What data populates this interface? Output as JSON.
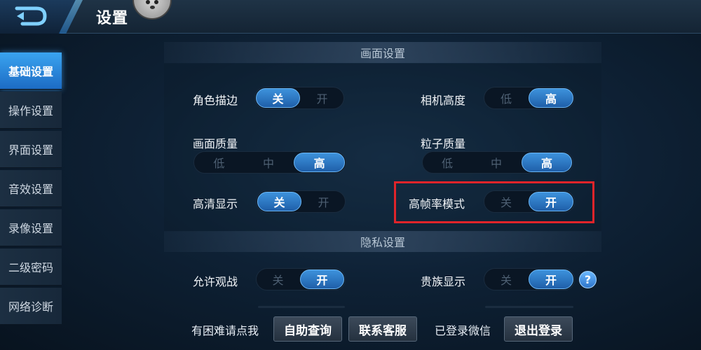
{
  "header": {
    "title": "设置"
  },
  "sidebar": {
    "items": [
      {
        "label": "基础设置",
        "active": true
      },
      {
        "label": "操作设置"
      },
      {
        "label": "界面设置"
      },
      {
        "label": "音效设置"
      },
      {
        "label": "录像设置"
      },
      {
        "label": "二级密码"
      },
      {
        "label": "网络诊断"
      }
    ]
  },
  "display_section": {
    "title": "画面设置",
    "settings": {
      "outline": {
        "label": "角色描边",
        "options": [
          "关",
          "开"
        ],
        "selected": "关"
      },
      "camera_height": {
        "label": "相机高度",
        "options": [
          "低",
          "高"
        ],
        "selected": "高"
      },
      "image_quality": {
        "label": "画面质量",
        "options": [
          "低",
          "中",
          "高"
        ],
        "selected": "高"
      },
      "particle_quality": {
        "label": "粒子质量",
        "options": [
          "低",
          "中",
          "高"
        ],
        "selected": "高"
      },
      "hd_display": {
        "label": "高清显示",
        "options": [
          "关",
          "开"
        ],
        "selected": "关"
      },
      "high_fps": {
        "label": "高帧率模式",
        "options": [
          "关",
          "开"
        ],
        "selected": "开"
      }
    }
  },
  "privacy_section": {
    "title": "隐私设置",
    "settings": {
      "allow_spectate": {
        "label": "允许观战",
        "options": [
          "关",
          "开"
        ],
        "selected": "开"
      },
      "noble_display": {
        "label": "贵族显示",
        "options": [
          "关",
          "开"
        ],
        "selected": "开"
      }
    },
    "help_icon": "?"
  },
  "bottom_bar": {
    "help_text": "有困难请点我",
    "self_service_button": "自助查询",
    "contact_button": "联系客服",
    "wechat_status": "已登录微信",
    "logout_button": "退出登录"
  },
  "colors": {
    "accent": "#2f7fd0",
    "highlight_box": "#e0242a"
  }
}
